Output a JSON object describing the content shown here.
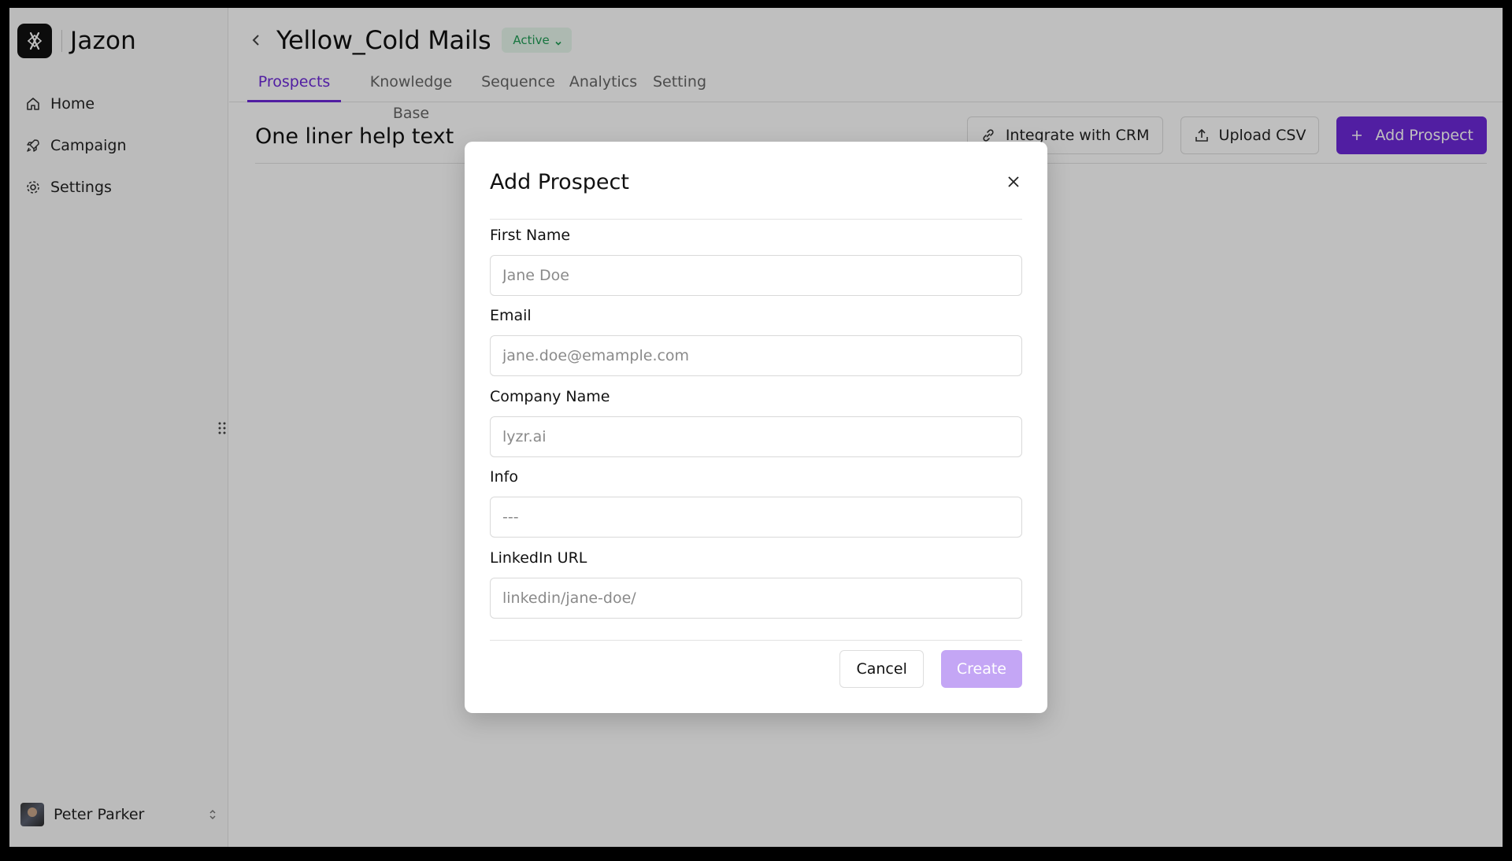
{
  "sidebar": {
    "brand": "Jazon",
    "nav": [
      {
        "label": "Home",
        "icon": "home-icon"
      },
      {
        "label": "Campaign",
        "icon": "rocket-icon"
      },
      {
        "label": "Settings",
        "icon": "gear-icon"
      }
    ],
    "user": {
      "name": "Peter Parker"
    }
  },
  "header": {
    "title": "Yellow_Cold Mails",
    "status": "Active",
    "status_color": "#1f9d55"
  },
  "tabs": [
    "Prospects",
    "Knowledge Base",
    "Sequence",
    "Analytics",
    "Setting"
  ],
  "active_tab": "Prospects",
  "subheader": {
    "title": "One liner help text",
    "actions": {
      "integrate": "Integrate with CRM",
      "upload": "Upload CSV",
      "add": "Add Prospect"
    }
  },
  "modal": {
    "title": "Add Prospect",
    "fields": [
      {
        "label": "First Name",
        "placeholder": "Jane Doe"
      },
      {
        "label": "Email",
        "placeholder": "jane.doe@emample.com"
      },
      {
        "label": "Company Name",
        "placeholder": "lyzr.ai"
      },
      {
        "label": "Info",
        "placeholder": "---"
      },
      {
        "label": "LinkedIn URL",
        "placeholder": "linkedin/jane-doe/"
      }
    ],
    "cancel": "Cancel",
    "create": "Create"
  },
  "colors": {
    "accent": "#6d28d9",
    "create_disabled": "#c4a6f5"
  }
}
